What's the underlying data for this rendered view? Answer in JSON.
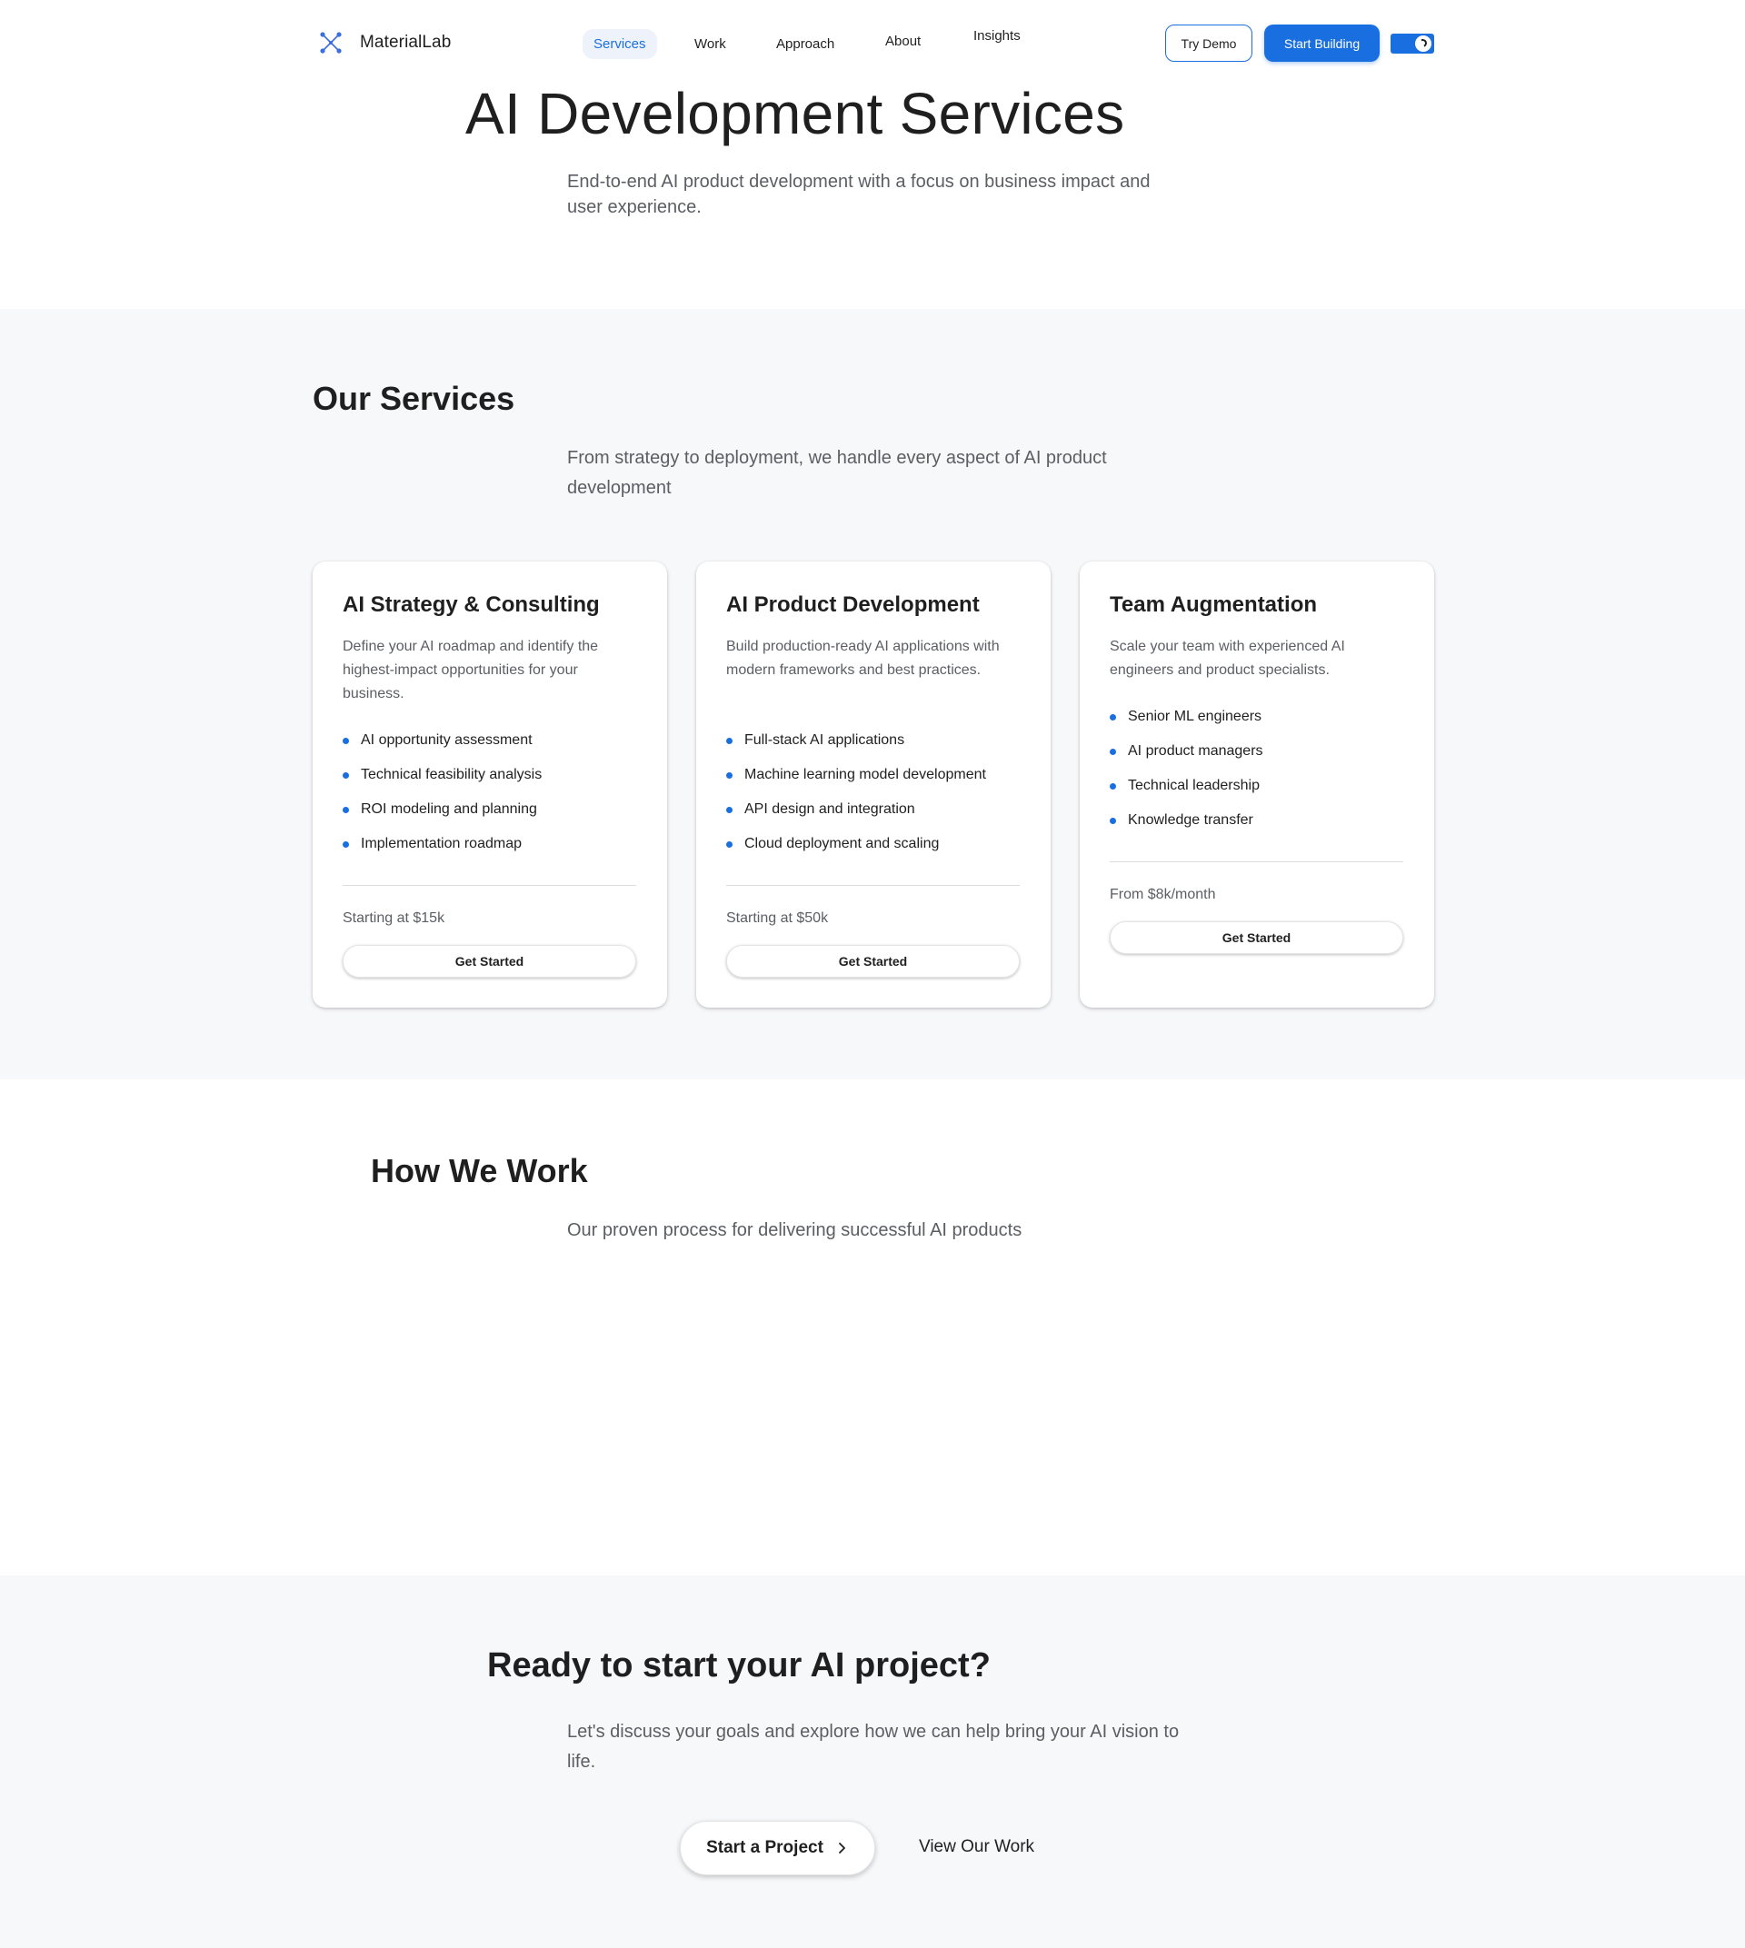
{
  "brand": {
    "name": "MaterialLab",
    "accent_color": "#1a6fe0",
    "logo_icon": "network-nodes-icon"
  },
  "nav": {
    "items": [
      {
        "label": "Services",
        "active": true
      },
      {
        "label": "Work",
        "active": false
      },
      {
        "label": "Approach",
        "active": false
      },
      {
        "label": "About",
        "active": false
      },
      {
        "label": "Insights",
        "active": false
      }
    ]
  },
  "header_actions": {
    "try_demo": "Try Demo",
    "start_building": "Start Building",
    "theme_toggle_icon": "theme-toggle-icon",
    "theme_toggle_on": true
  },
  "hero": {
    "title": "AI Development Services",
    "subtitle": "End-to-end AI product development with a focus on business impact and user experience."
  },
  "services": {
    "title": "Our Services",
    "subtitle": "From strategy to deployment, we handle every aspect of AI product development",
    "cards": [
      {
        "title": "AI Strategy & Consulting",
        "description": "Define your AI roadmap and identify the highest-impact opportunities for your business.",
        "features": [
          "AI opportunity assessment",
          "Technical feasibility analysis",
          "ROI modeling and planning",
          "Implementation roadmap"
        ],
        "price": "Starting at $15k",
        "cta": "Get Started"
      },
      {
        "title": "AI Product Development",
        "description": "Build production-ready AI applications with modern frameworks and best practices.",
        "features": [
          "Full-stack AI applications",
          "Machine learning model development",
          "API design and integration",
          "Cloud deployment and scaling"
        ],
        "price": "Starting at $50k",
        "cta": "Get Started"
      },
      {
        "title": "Team Augmentation",
        "description": "Scale your team with experienced AI engineers and product specialists.",
        "features": [
          "Senior ML engineers",
          "AI product managers",
          "Technical leadership",
          "Knowledge transfer"
        ],
        "price": "From $8k/month",
        "cta": "Get Started"
      }
    ]
  },
  "process": {
    "title": "How We Work",
    "subtitle": "Our proven process for delivering successful AI products"
  },
  "cta": {
    "title": "Ready to start your AI project?",
    "subtitle": "Let's discuss your goals and explore how we can help bring your AI vision to life.",
    "primary": "Start a Project",
    "primary_icon": "chevron-right-icon",
    "secondary": "View Our Work"
  }
}
